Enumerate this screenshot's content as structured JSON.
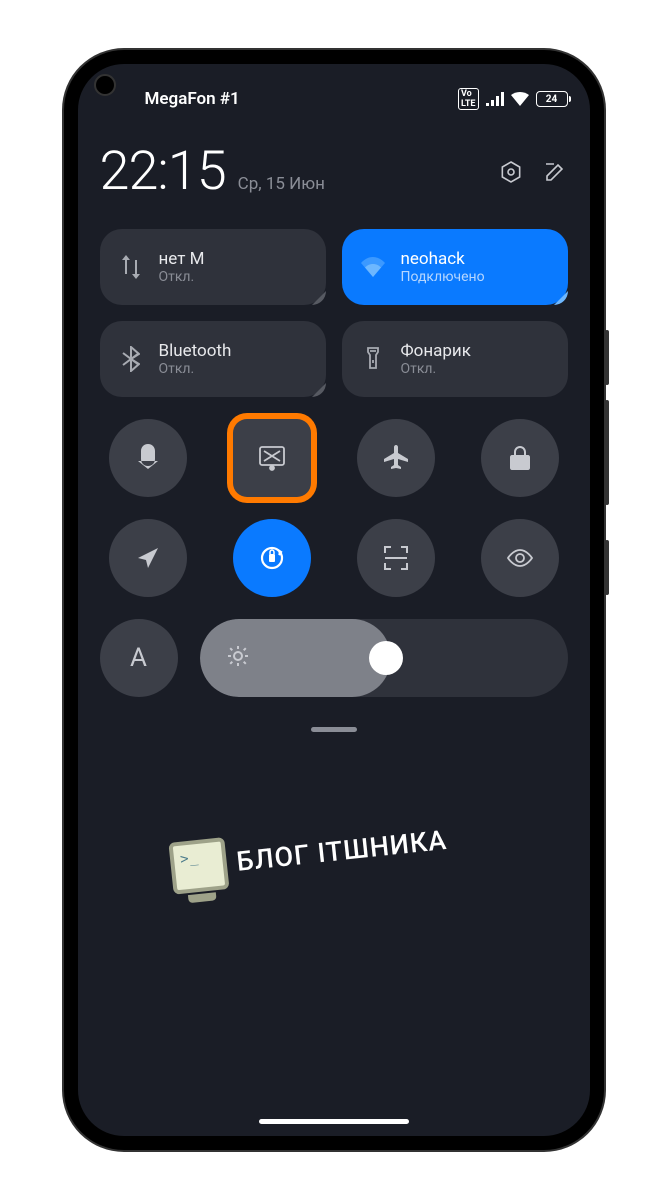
{
  "status": {
    "carrier": "MegaFon #1",
    "volte": "Vo\nLTE",
    "battery": "24"
  },
  "header": {
    "time": "22:15",
    "date": "Ср, 15 Июн"
  },
  "tiles": {
    "data": {
      "title": "нет    М",
      "sub": "Откл."
    },
    "wifi": {
      "title": "neohack",
      "sub": "Подключено"
    },
    "bluetooth": {
      "title": "Bluetooth",
      "sub": "Откл."
    },
    "flashlight": {
      "title": "Фонарик",
      "sub": "Откл."
    }
  },
  "brightness": {
    "auto_label": "A"
  },
  "watermark": {
    "prompt": ">_",
    "text": "БЛОГ ІТШНИКА"
  }
}
